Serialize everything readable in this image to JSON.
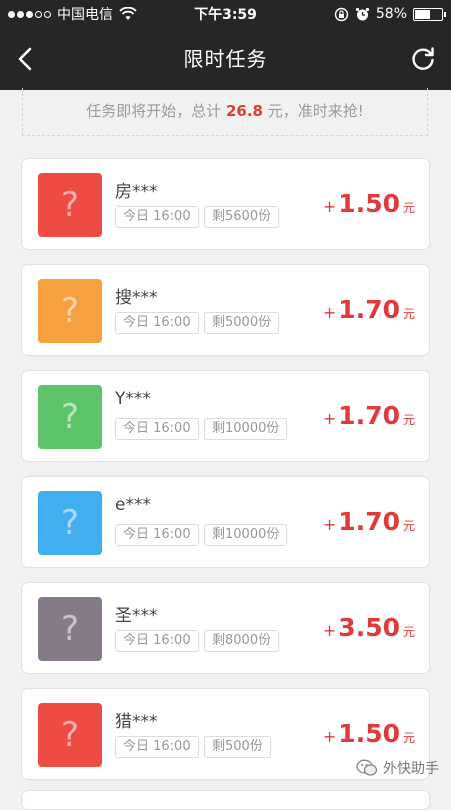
{
  "status_bar": {
    "carrier": "中国电信",
    "time": "下午3:59",
    "battery": "58%",
    "battery_level": 0.58
  },
  "nav": {
    "title": "限时任务"
  },
  "banner": {
    "prefix": "任务即将开始，总计 ",
    "amount": "26.8",
    "suffix": " 元，准时来抢!"
  },
  "tasks": [
    {
      "name": "房***",
      "time": "今日 16:00",
      "remaining": "剩5600份",
      "plus": "+",
      "reward": "1.50",
      "unit": "元",
      "color": "#ee4b45"
    },
    {
      "name": "搜***",
      "time": "今日 16:00",
      "remaining": "剩5000份",
      "plus": "+",
      "reward": "1.70",
      "unit": "元",
      "color": "#f6a03f"
    },
    {
      "name": "Y***",
      "time": "今日 16:00",
      "remaining": "剩10000份",
      "plus": "+",
      "reward": "1.70",
      "unit": "元",
      "color": "#5dc46a"
    },
    {
      "name": "e***",
      "time": "今日 16:00",
      "remaining": "剩10000份",
      "plus": "+",
      "reward": "1.70",
      "unit": "元",
      "color": "#41aef0"
    },
    {
      "name": "圣***",
      "time": "今日 16:00",
      "remaining": "剩8000份",
      "plus": "+",
      "reward": "3.50",
      "unit": "元",
      "color": "#857a88"
    },
    {
      "name": "猎***",
      "time": "今日 16:00",
      "remaining": "剩500份",
      "plus": "+",
      "reward": "1.50",
      "unit": "元",
      "color": "#ee4b45"
    }
  ],
  "watermark": {
    "text": "外快助手"
  },
  "icons": {
    "back": "chevron-left-icon",
    "refresh": "refresh-icon",
    "wifi": "wifi-icon",
    "lock": "rotation-lock-icon",
    "alarm": "alarm-icon",
    "battery": "battery-icon",
    "task": "question-mark-icon",
    "watermark": "wechat-logo"
  }
}
